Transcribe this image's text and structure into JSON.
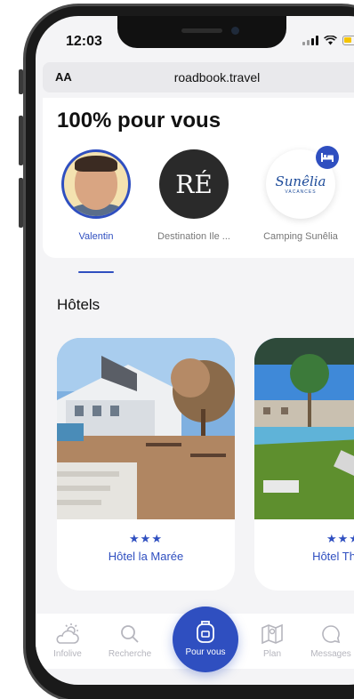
{
  "status": {
    "time": "12:03"
  },
  "browser": {
    "text_size_label": "AA",
    "url": "roadbook.travel"
  },
  "header": {
    "title": "100% pour vous"
  },
  "stories": [
    {
      "label": "Valentin",
      "active": true
    },
    {
      "label": "Destination Ile ...",
      "logo_text": "RÉ"
    },
    {
      "label": "Camping Sunêlia",
      "logo_text": "Sunêlia",
      "logo_sub": "VACANCES"
    }
  ],
  "hotels": {
    "section_title": "Hôtels",
    "items": [
      {
        "name": "Hôtel la Marée",
        "stars": "★★★"
      },
      {
        "name": "Hôtel The O",
        "stars": "★★★"
      }
    ]
  },
  "tabbar": {
    "items": [
      {
        "label": "Infolive",
        "icon": "weather-icon"
      },
      {
        "label": "Recherche",
        "icon": "search-icon"
      },
      {
        "label": "Pour vous",
        "icon": "backpack-icon",
        "active": true
      },
      {
        "label": "Plan",
        "icon": "map-icon"
      },
      {
        "label": "Messages",
        "icon": "chat-icon"
      }
    ]
  },
  "colors": {
    "accent": "#2f4fc0",
    "inactive": "#b5b5bd",
    "battery": "#f5c400"
  }
}
